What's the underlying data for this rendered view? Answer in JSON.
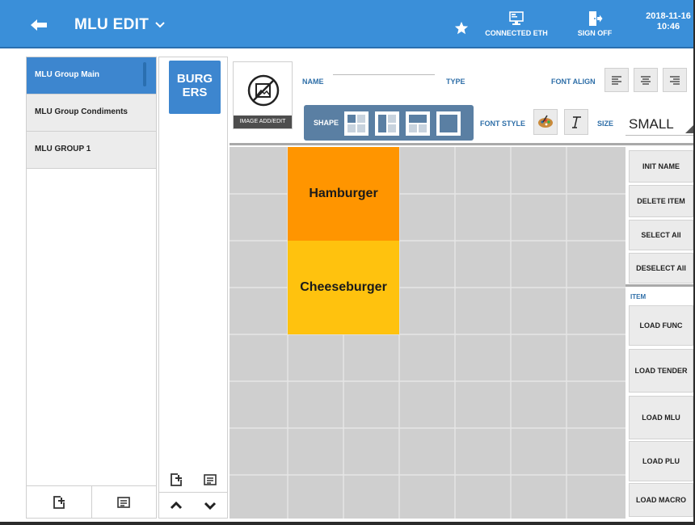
{
  "topbar": {
    "title": "MLU EDIT",
    "connection_label": "CONNECTED ETH",
    "signoff_label": "SIGN OFF",
    "date": "2018-11-16",
    "time": "10:46",
    "bg_color": "#3a8fd9"
  },
  "groups": [
    {
      "label": "MLU Group Main",
      "active": true
    },
    {
      "label": "MLU Group Condiments",
      "active": false
    },
    {
      "label": "MLU GROUP 1",
      "active": false
    }
  ],
  "subgroup": {
    "label_line1": "BURG",
    "label_line2": "ERS"
  },
  "editor": {
    "image_button_label": "IMAGE ADD/EDIT",
    "name_label": "NAME",
    "name_value": "",
    "type_label": "TYPE",
    "type_value": "",
    "font_align_label": "FONT ALIGN",
    "shape_label": "SHAPE",
    "font_style_label": "FONT STYLE",
    "size_label": "SIZE",
    "size_value": "SMALL"
  },
  "tiles": [
    {
      "label": "Hamburger",
      "color": "#ff9500"
    },
    {
      "label": "Cheeseburger",
      "color": "#ffc20e"
    }
  ],
  "actions": {
    "init_name": "INIT NAME",
    "delete_item": "DELETE ITEM",
    "select_all": "SELECT All",
    "deselect_all": "DESELECT All",
    "item_section_label": "ITEM",
    "load_func": "LOAD FUNC",
    "load_tender": "LOAD TENDER",
    "load_mlu": "LOAD MLU",
    "load_plu": "LOAD PLU",
    "load_macro": "LOAD MACRO"
  },
  "icons": {
    "back": "arrow-left-icon",
    "title_dropdown": "chevron-down-icon",
    "favorite": "star-icon",
    "connection": "monitor-icon",
    "signoff": "exit-door-icon",
    "add": "add-page-icon",
    "list": "list-icon",
    "up": "chevron-up-icon",
    "down": "chevron-down-icon",
    "image": "image-edit-icon",
    "palette": "palette-icon",
    "italic": "italic-t-icon"
  }
}
